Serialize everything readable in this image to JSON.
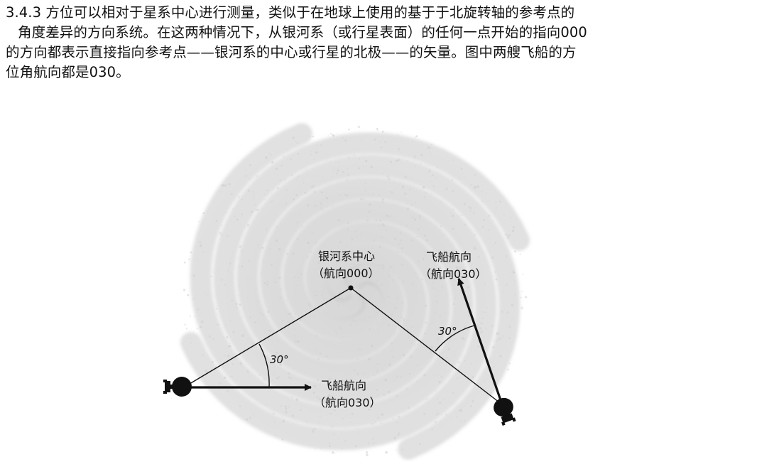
{
  "caption": {
    "line1": "3.4.3 方位可以相对于星系中心进行测量，类似于在地球上使用的基于于北旋转轴的参考点的",
    "line2": "角度差异的方向系统。在这两种情况下，从银河系（或行星表面）的任何一点开始的指向000",
    "line3": "的方向都表示直接指向参考点——银河系的中心或行星的北极——的矢量。图中两艘飞船的方",
    "line4": "位角航向都是030。"
  },
  "diagram": {
    "center_label": "银河系中心",
    "center_heading": "（航向000）",
    "ship_right_label": "飞船航向",
    "ship_right_heading": "（航向030）",
    "ship_left_label": "飞船航向",
    "ship_left_heading": "（航向030）",
    "angle_left": "30°",
    "angle_right": "30°"
  },
  "colors": {
    "text": "#111111",
    "galaxy": "#c8c8c8",
    "lines": "#111111"
  }
}
